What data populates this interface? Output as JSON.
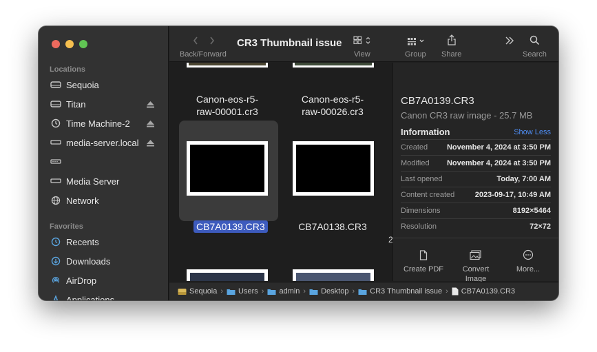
{
  "window": {
    "title": "CR3 Thumbnail issue"
  },
  "toolbar": {
    "back_forward_label": "Back/Forward",
    "view_label": "View",
    "group_label": "Group",
    "share_label": "Share",
    "search_label": "Search"
  },
  "sidebar": {
    "locations_heading": "Locations",
    "locations": [
      {
        "label": "Sequoia",
        "icon": "hard-drive-icon",
        "eject": false
      },
      {
        "label": "Titan",
        "icon": "hard-drive-icon",
        "eject": true
      },
      {
        "label": "Time Machine-2",
        "icon": "time-machine-icon",
        "eject": true
      },
      {
        "label": "media-server.local",
        "icon": "server-icon",
        "eject": true
      },
      {
        "label": "",
        "icon": "network-device-icon",
        "eject": false
      },
      {
        "label": "Media Server",
        "icon": "server-icon",
        "eject": false
      },
      {
        "label": "Network",
        "icon": "globe-icon",
        "eject": false
      }
    ],
    "favorites_heading": "Favorites",
    "favorites": [
      {
        "label": "Recents",
        "icon": "clock-icon"
      },
      {
        "label": "Downloads",
        "icon": "download-icon"
      },
      {
        "label": "AirDrop",
        "icon": "airdrop-icon"
      },
      {
        "label": "Applications",
        "icon": "applications-icon"
      }
    ]
  },
  "files": [
    {
      "name_line1": "Canon-eos-r5-",
      "name_line2": "raw-00001.cr3"
    },
    {
      "name_line1": "Canon-eos-r5-",
      "name_line2": "raw-00026.cr3"
    },
    {
      "name": "CB7A0139.CR3",
      "selected": true
    },
    {
      "name": "CB7A0138.CR3",
      "selected": false
    }
  ],
  "edge_char": "2",
  "preview": {
    "file_name": "CB7A0139.CR3",
    "kind": "Canon CR3 raw image - 25.7 MB",
    "info_heading": "Information",
    "show_less": "Show Less",
    "rows": [
      {
        "key": "Created",
        "value": "November 4, 2024 at 3:50 PM"
      },
      {
        "key": "Modified",
        "value": "November 4, 2024 at 3:50 PM"
      },
      {
        "key": "Last opened",
        "value": "Today, 7:00 AM"
      },
      {
        "key": "Content created",
        "value": "2023-09-17, 10:49 AM"
      },
      {
        "key": "Dimensions",
        "value": "8192×5464"
      },
      {
        "key": "Resolution",
        "value": "72×72"
      }
    ],
    "actions": [
      {
        "label_line1": "Create PDF",
        "label_line2": ""
      },
      {
        "label_line1": "Convert",
        "label_line2": "Image"
      },
      {
        "label_line1": "More...",
        "label_line2": ""
      }
    ]
  },
  "path": [
    "Sequoia",
    "Users",
    "admin",
    "Desktop",
    "CR3 Thumbnail issue",
    "CB7A0139.CR3"
  ],
  "colors": {
    "accent": "#3d5bbd",
    "link": "#4f8ff7",
    "folder": "#5aa5e0"
  }
}
